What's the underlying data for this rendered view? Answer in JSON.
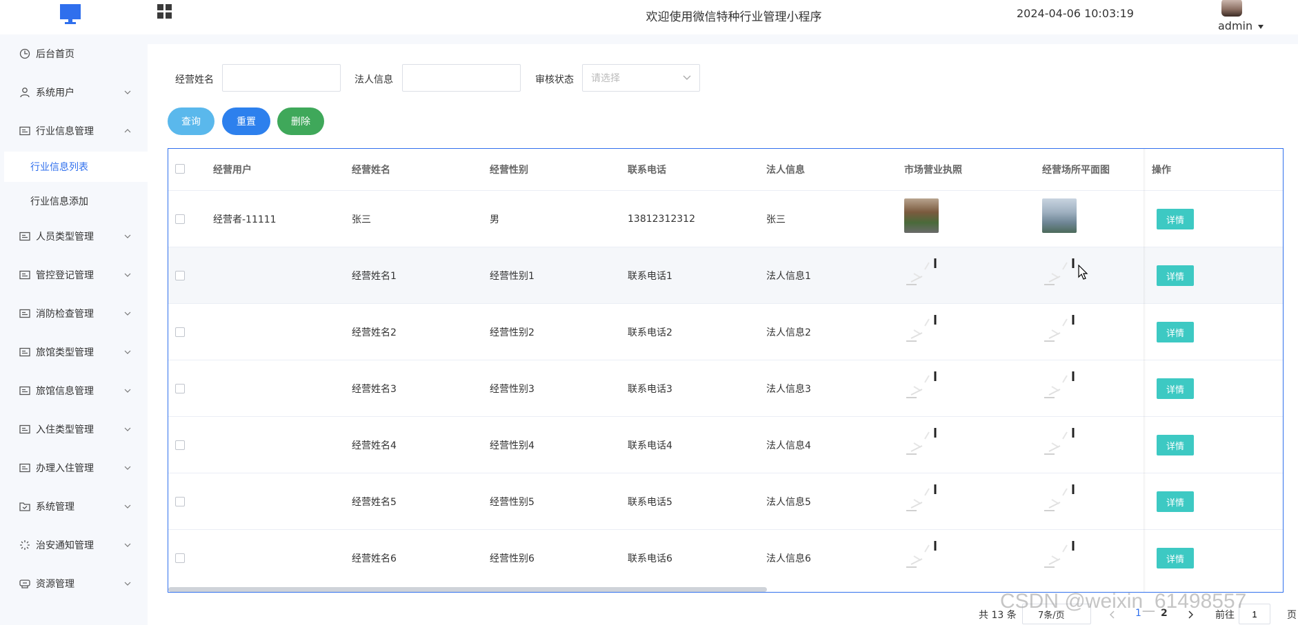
{
  "header": {
    "app_title": "欢迎使用微信特种行业管理小程序",
    "datetime": "2024-04-06 10:03:19",
    "user_name": "admin"
  },
  "sidebar": {
    "items": [
      {
        "label": "后台首页",
        "icon": "clock-icon"
      },
      {
        "label": "系统用户",
        "icon": "user-icon"
      },
      {
        "label": "行业信息管理",
        "icon": "card-icon",
        "expanded": true
      },
      {
        "label": "人员类型管理",
        "icon": "card-icon"
      },
      {
        "label": "管控登记管理",
        "icon": "card-icon"
      },
      {
        "label": "消防检查管理",
        "icon": "card-icon"
      },
      {
        "label": "旅馆类型管理",
        "icon": "card-icon"
      },
      {
        "label": "旅馆信息管理",
        "icon": "card-icon"
      },
      {
        "label": "入住类型管理",
        "icon": "card-icon"
      },
      {
        "label": "办理入住管理",
        "icon": "card-icon"
      },
      {
        "label": "系统管理",
        "icon": "folder-icon"
      },
      {
        "label": "治安通知管理",
        "icon": "loading-icon"
      },
      {
        "label": "资源管理",
        "icon": "box-icon"
      }
    ],
    "sub_items": [
      {
        "label": "行业信息列表",
        "active": true
      },
      {
        "label": "行业信息添加",
        "active": false
      }
    ]
  },
  "filters": {
    "name_label": "经营姓名",
    "name_value": "",
    "legal_label": "法人信息",
    "legal_value": "",
    "status_label": "审核状态",
    "status_placeholder": "请选择"
  },
  "actions": {
    "query": "查询",
    "reset": "重置",
    "delete": "删除"
  },
  "table": {
    "columns": [
      "经营用户",
      "经营姓名",
      "经营性别",
      "联系电话",
      "法人信息",
      "市场营业执照",
      "经营场所平面图",
      "操作"
    ],
    "detail_label": "详情",
    "rows": [
      {
        "user": "经营者-11111",
        "name": "张三",
        "gender": "男",
        "phone": "13812312312",
        "legal": "张三",
        "has_images": true
      },
      {
        "user": "",
        "name": "经营姓名1",
        "gender": "经营性别1",
        "phone": "联系电话1",
        "legal": "法人信息1",
        "has_images": false
      },
      {
        "user": "",
        "name": "经营姓名2",
        "gender": "经营性别2",
        "phone": "联系电话2",
        "legal": "法人信息2",
        "has_images": false
      },
      {
        "user": "",
        "name": "经营姓名3",
        "gender": "经营性别3",
        "phone": "联系电话3",
        "legal": "法人信息3",
        "has_images": false
      },
      {
        "user": "",
        "name": "经营姓名4",
        "gender": "经营性别4",
        "phone": "联系电话4",
        "legal": "法人信息4",
        "has_images": false
      },
      {
        "user": "",
        "name": "经营姓名5",
        "gender": "经营性别5",
        "phone": "联系电话5",
        "legal": "法人信息5",
        "has_images": false
      },
      {
        "user": "",
        "name": "经营姓名6",
        "gender": "经营性别6",
        "phone": "联系电话6",
        "legal": "法人信息6",
        "has_images": false
      }
    ]
  },
  "pagination": {
    "total": "共 13 条",
    "page_size": "7条/页",
    "pages": [
      "1",
      "2"
    ],
    "current_page": "1",
    "goto_label": "前往",
    "goto_value": "1",
    "page_suffix": "页"
  },
  "watermark": "CSDN @weixin_61498557",
  "colors": {
    "accent": "#2f6fed",
    "query_button": "#5ab8ec",
    "reset_button": "#2d80ed",
    "delete_button": "#3fa85a",
    "detail_button": "#3dc9c3"
  }
}
